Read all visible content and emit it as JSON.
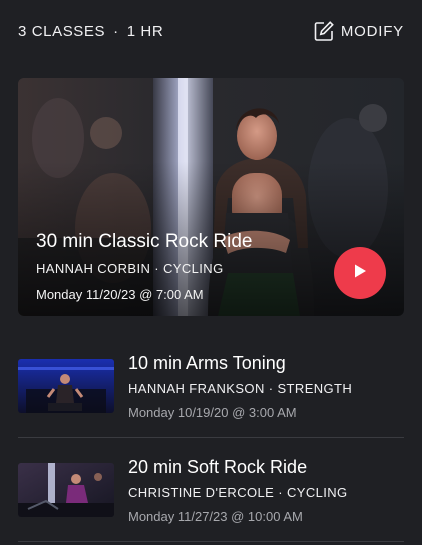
{
  "header": {
    "class_count": "3 CLASSES",
    "separator": "·",
    "duration": "1 HR",
    "modify_label": "MODIFY",
    "modify_icon": "edit-icon"
  },
  "featured": {
    "title": "30 min Classic Rock Ride",
    "instructor_line": "HANNAH CORBIN · CYCLING",
    "date": "Monday 11/20/23 @ 7:00 AM",
    "play_icon": "play-icon",
    "accent_color": "#ee3b4b"
  },
  "classes": [
    {
      "title": "10 min Arms Toning",
      "instructor_line": "HANNAH FRANKSON · STRENGTH",
      "date": "Monday 10/19/20 @ 3:00 AM"
    },
    {
      "title": "20 min Soft Rock Ride",
      "instructor_line": "CHRISTINE D'ERCOLE · CYCLING",
      "date": "Monday 11/27/23 @ 10:00 AM"
    }
  ]
}
